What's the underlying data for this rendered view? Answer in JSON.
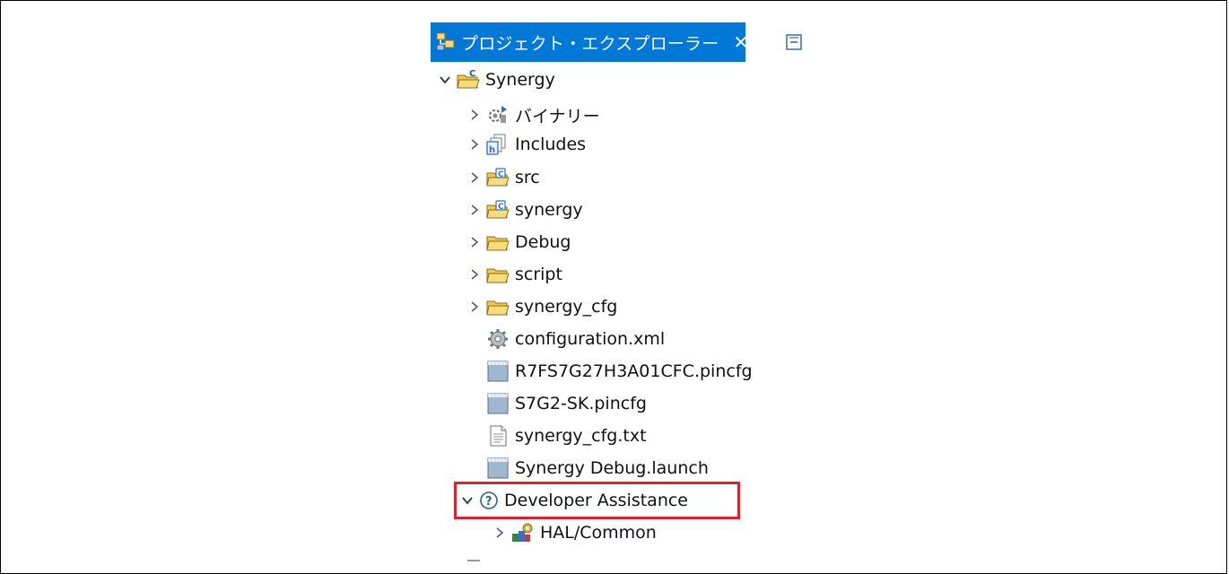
{
  "view": {
    "tab_title": "プロジェクト・エクスプローラー",
    "close_symbol": "✕"
  },
  "tree": {
    "root": {
      "label": "Synergy",
      "icon": "c-project-folder-icon",
      "expanded": true
    },
    "children": [
      {
        "label": "バイナリー",
        "icon": "binaries-icon",
        "expandable": true
      },
      {
        "label": "Includes",
        "icon": "includes-icon",
        "expandable": true
      },
      {
        "label": "src",
        "icon": "source-folder-icon",
        "expandable": true
      },
      {
        "label": "synergy",
        "icon": "source-folder-icon",
        "expandable": true
      },
      {
        "label": "Debug",
        "icon": "folder-icon",
        "expandable": true
      },
      {
        "label": "script",
        "icon": "folder-icon",
        "expandable": true
      },
      {
        "label": "synergy_cfg",
        "icon": "folder-icon",
        "expandable": true
      },
      {
        "label": "configuration.xml",
        "icon": "gear-config-icon",
        "expandable": false
      },
      {
        "label": "R7FS7G27H3A01CFC.pincfg",
        "icon": "pincfg-file-icon",
        "expandable": false
      },
      {
        "label": "S7G2-SK.pincfg",
        "icon": "pincfg-file-icon",
        "expandable": false
      },
      {
        "label": "synergy_cfg.txt",
        "icon": "text-file-icon",
        "expandable": false
      },
      {
        "label": "Synergy Debug.launch",
        "icon": "launch-file-icon",
        "expandable": false
      }
    ],
    "developer_assistance": {
      "label": "Developer Assistance",
      "icon": "help-circle-icon",
      "expanded": true,
      "highlight_color": "#e0212c"
    },
    "da_children": [
      {
        "label": "HAL/Common",
        "icon": "hal-modules-icon",
        "expandable": true
      }
    ]
  },
  "colors": {
    "tab_active_bg": "#0078d7",
    "folder_yellow": "#f2c94c",
    "highlight": "#e0212c"
  }
}
